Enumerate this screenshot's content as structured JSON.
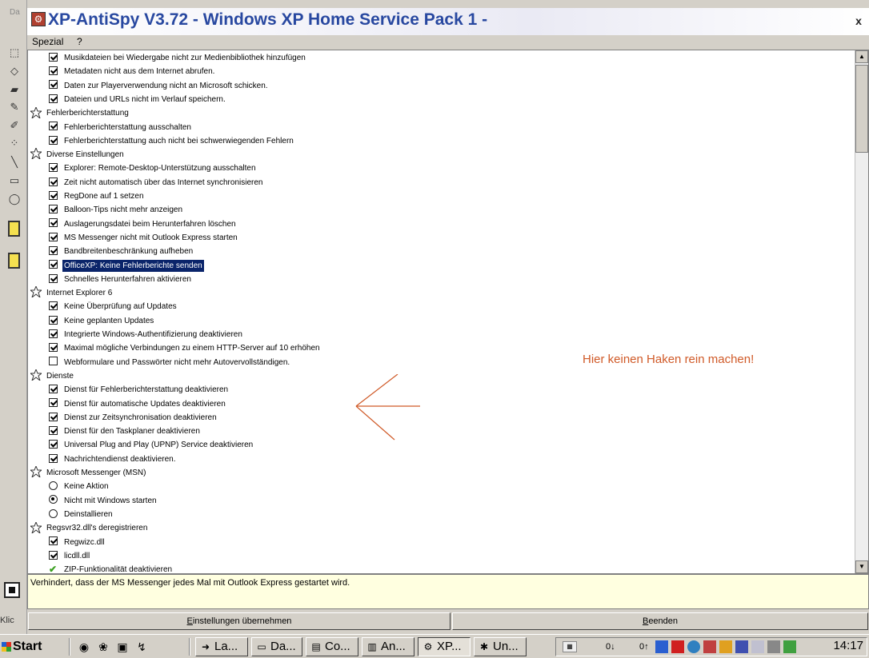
{
  "window": {
    "title": "XP-AntiSpy V3.72 - Windows XP Home Service Pack 1 -",
    "close_label": "x"
  },
  "menu": {
    "items": [
      "Spezial",
      "?"
    ]
  },
  "tree": {
    "rows": [
      {
        "type": "check",
        "checked": true,
        "text": "Musikdateien bei Wiedergabe nicht zur Medienbibliothek hinzufügen"
      },
      {
        "type": "check",
        "checked": true,
        "text": "Metadaten nicht aus dem Internet abrufen."
      },
      {
        "type": "check",
        "checked": true,
        "text": "Daten zur Playerverwendung nicht an Microsoft schicken."
      },
      {
        "type": "check",
        "checked": true,
        "text": "Dateien und URLs nicht im Verlauf speichern."
      },
      {
        "type": "category",
        "text": "Fehlerberichterstattung"
      },
      {
        "type": "check",
        "checked": true,
        "text": "Fehlerberichterstattung ausschalten"
      },
      {
        "type": "check",
        "checked": true,
        "text": "Fehlerberichterstattung auch nicht bei schwerwiegenden Fehlern"
      },
      {
        "type": "category",
        "text": "Diverse Einstellungen"
      },
      {
        "type": "check",
        "checked": true,
        "text": "Explorer: Remote-Desktop-Unterstützung ausschalten"
      },
      {
        "type": "check",
        "checked": true,
        "text": "Zeit nicht automatisch über das Internet synchronisieren"
      },
      {
        "type": "check",
        "checked": true,
        "text": "RegDone auf 1 setzen"
      },
      {
        "type": "check",
        "checked": true,
        "text": "Balloon-Tips nicht mehr anzeigen"
      },
      {
        "type": "check",
        "checked": true,
        "text": "Auslagerungsdatei beim Herunterfahren löschen"
      },
      {
        "type": "check",
        "checked": true,
        "text": "MS Messenger nicht mit Outlook Express starten"
      },
      {
        "type": "check",
        "checked": true,
        "text": "Bandbreitenbeschränkung aufheben"
      },
      {
        "type": "check",
        "checked": true,
        "text": "OfficeXP: Keine Fehlerberichte senden",
        "selected": true
      },
      {
        "type": "check",
        "checked": true,
        "text": "Schnelles Herunterfahren aktivieren"
      },
      {
        "type": "category",
        "text": "Internet Explorer 6"
      },
      {
        "type": "check",
        "checked": true,
        "text": "Keine Überprüfung auf Updates"
      },
      {
        "type": "check",
        "checked": true,
        "text": "Keine geplanten Updates"
      },
      {
        "type": "check",
        "checked": true,
        "text": "Integrierte Windows-Authentifizierung deaktivieren"
      },
      {
        "type": "check",
        "checked": true,
        "text": "Maximal mögliche Verbindungen zu einem HTTP-Server auf 10 erhöhen"
      },
      {
        "type": "check",
        "checked": false,
        "text": "Webformulare und Passwörter nicht mehr Autovervollständigen."
      },
      {
        "type": "category",
        "text": "Dienste"
      },
      {
        "type": "check",
        "checked": true,
        "text": "Dienst für Fehlerberichterstattung deaktivieren"
      },
      {
        "type": "check",
        "checked": true,
        "text": "Dienst für automatische Updates deaktivieren"
      },
      {
        "type": "check",
        "checked": true,
        "text": "Dienst zur Zeitsynchronisation deaktivieren"
      },
      {
        "type": "check",
        "checked": true,
        "text": "Dienst für den Taskplaner deaktivieren"
      },
      {
        "type": "check",
        "checked": true,
        "text": "Universal Plug and Play (UPNP) Service deaktivieren"
      },
      {
        "type": "check",
        "checked": true,
        "text": "Nachrichtendienst deaktivieren."
      },
      {
        "type": "category",
        "text": "Microsoft Messenger (MSN)"
      },
      {
        "type": "radio",
        "checked": false,
        "text": "Keine Aktion"
      },
      {
        "type": "radio",
        "checked": true,
        "text": "Nicht mit Windows starten"
      },
      {
        "type": "radio",
        "checked": false,
        "text": "Deinstallieren"
      },
      {
        "type": "category",
        "text": "Regsvr32.dll's deregistrieren"
      },
      {
        "type": "check",
        "checked": true,
        "text": "Regwizc.dll"
      },
      {
        "type": "check",
        "checked": true,
        "text": "licdll.dll"
      },
      {
        "type": "done",
        "text": "ZIP-Funktionalität deaktivieren"
      }
    ]
  },
  "annotation": {
    "text": "Hier keinen Haken rein machen!"
  },
  "status": {
    "text": "Verhindert, dass der MS Messenger jedes Mal mit Outlook Express gestartet wird."
  },
  "buttons": {
    "apply_first": "E",
    "apply_rest": "instellungen übernehmen",
    "quit_first": "B",
    "quit_rest": "eenden"
  },
  "leftstrip": {
    "top_label": "Da",
    "bottom_label": "Klic"
  },
  "taskbar": {
    "start": "Start",
    "items": [
      {
        "label": "La...",
        "icon": "arrow-icon"
      },
      {
        "label": "Da...",
        "icon": "window-icon"
      },
      {
        "label": "Co...",
        "icon": "folder-icon"
      },
      {
        "label": "An...",
        "icon": "doc-icon"
      },
      {
        "label": "XP...",
        "icon": "antispy-icon",
        "active": true
      },
      {
        "label": "Un...",
        "icon": "app-icon"
      }
    ],
    "tray": {
      "down": "0↓",
      "up": "0↑",
      "clock": "14:17"
    }
  },
  "colors": {
    "selection": "#0a246a",
    "annotation": "#d05a28",
    "title_text": "#2848a0"
  }
}
